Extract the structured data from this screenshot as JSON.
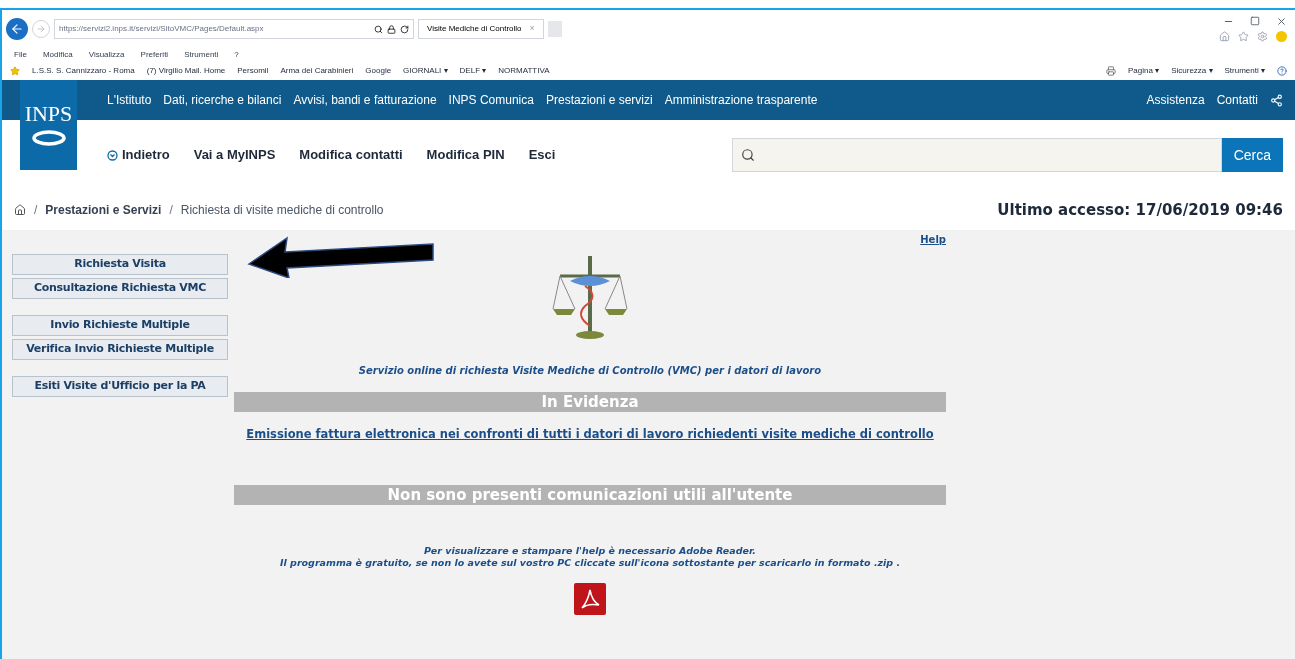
{
  "browser": {
    "address": "https://servizi2.inps.it/servizi/SitoVMC/Pages/Default.aspx",
    "tab": {
      "title": "Visite Mediche di Controllo",
      "close": "×"
    },
    "menu": [
      "File",
      "Modifica",
      "Visualizza",
      "Preferiti",
      "Strumenti",
      "?"
    ],
    "favorites": [
      "L.S.S. S. Cannizzaro - Roma",
      "(7) Virgilio Mail. Home",
      "Persomil",
      "Arma dei Carabinieri",
      "Google",
      "GIORNALI ▾",
      "DELF ▾",
      "NORMATTIVA"
    ],
    "command_bar": [
      "Pagina ▾",
      "Sicurezza ▾",
      "Strumenti ▾"
    ]
  },
  "site": {
    "logo": "INPS",
    "top_nav": [
      "L'Istituto",
      "Dati, ricerche e bilanci",
      "Avvisi, bandi e fatturazione",
      "INPS Comunica",
      "Prestazioni e servizi",
      "Amministrazione trasparente"
    ],
    "top_right": [
      "Assistenza",
      "Contatti"
    ],
    "user_nav": [
      "Indietro",
      "Vai a MyINPS",
      "Modifica contatti",
      "Modifica PIN",
      "Esci"
    ],
    "search": {
      "button": "Cerca"
    },
    "breadcrumb": [
      "Prestazioni e Servizi",
      "Richiesta di visite mediche di controllo"
    ],
    "breadcrumb_separator": "/",
    "last_access": "Ultimo accesso: 17/06/2019 09:46"
  },
  "content": {
    "help": "Help",
    "menu_groups": [
      [
        "Richiesta Visita",
        "Consultazione Richiesta VMC"
      ],
      [
        "Invio Richieste Multiple",
        "Verifica Invio Richieste Multiple"
      ],
      [
        "Esiti Visite d'Ufficio per la PA"
      ]
    ],
    "service_text": "Servizio online di richiesta Visite Mediche di Controllo (VMC) per i datori di lavoro",
    "highlight_title": "In Evidenza",
    "highlight_link": "Emissione fattura elettronica nei confronti di tutti i datori di lavoro richiedenti visite mediche di controllo",
    "notice": "Non sono presenti comunicazioni utili all'utente",
    "reader_lines": [
      "Per visualizzare e stampare l'help è necessario Adobe Reader.",
      "Il programma è gratuito, se non lo avete sul vostro PC cliccate sull'icona sottostante per scaricarlo in formato .zip ."
    ]
  }
}
